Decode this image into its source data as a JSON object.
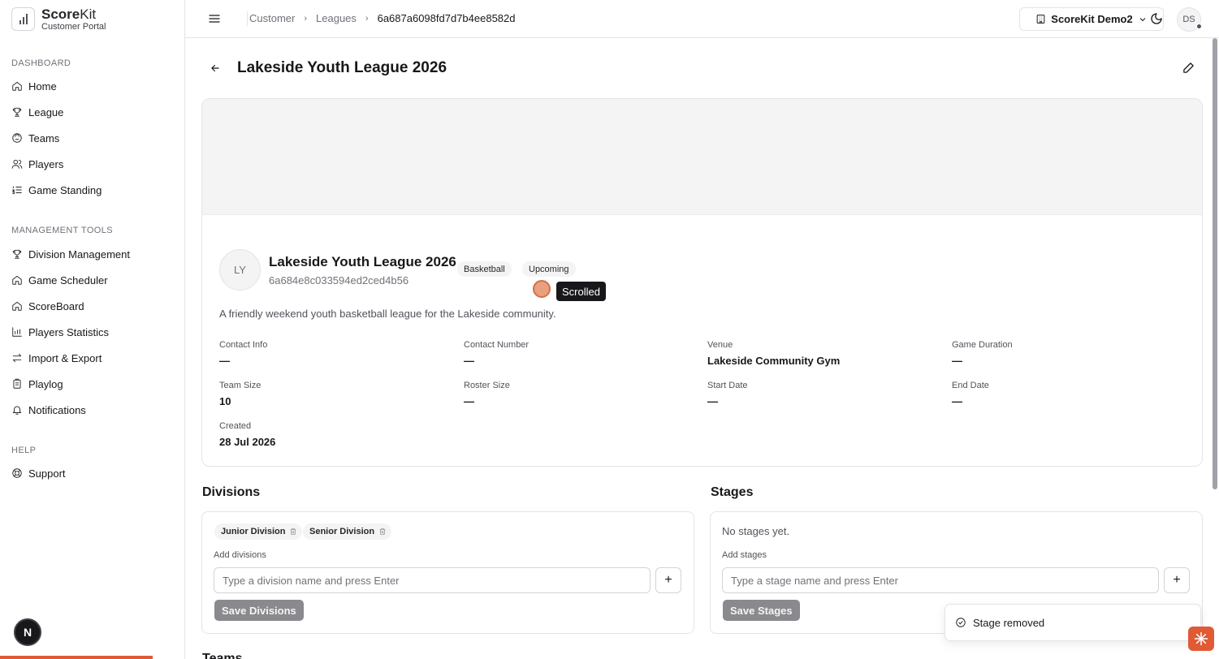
{
  "brand": {
    "name_bold": "Score",
    "name_regular": "Kit",
    "subtitle": "Customer Portal"
  },
  "sidebar": {
    "sections": [
      {
        "title": "DASHBOARD",
        "items": [
          "Home",
          "League",
          "Teams",
          "Players",
          "Game Standing"
        ]
      },
      {
        "title": "MANAGEMENT TOOLS",
        "items": [
          "Division Management",
          "Game Scheduler",
          "ScoreBoard",
          "Players Statistics",
          "Import & Export",
          "Playlog",
          "Notifications"
        ]
      },
      {
        "title": "HELP",
        "items": [
          "Support"
        ]
      }
    ],
    "bottom_badge": "N"
  },
  "topbar": {
    "breadcrumbs": [
      "Customer",
      "Leagues",
      "6a687a6098fd7d7b4ee8582d"
    ],
    "org": "ScoreKit Demo2",
    "user_initials": "DS"
  },
  "page": {
    "title": "Lakeside Youth League 2026"
  },
  "league": {
    "initials": "LY",
    "name": "Lakeside Youth League 2026",
    "id": "6a684e8c033594ed2ced4b56",
    "sport": "Basketball",
    "status": "Upcoming",
    "description": "A friendly weekend youth basketball league for the Lakeside community.",
    "fields": [
      {
        "label": "Contact Info",
        "value": "—"
      },
      {
        "label": "Contact Number",
        "value": "—"
      },
      {
        "label": "Venue",
        "value": "Lakeside Community Gym"
      },
      {
        "label": "Game Duration",
        "value": "—"
      },
      {
        "label": "Team Size",
        "value": "10"
      },
      {
        "label": "Roster Size",
        "value": "—"
      },
      {
        "label": "Start Date",
        "value": "—"
      },
      {
        "label": "End Date",
        "value": "—"
      },
      {
        "label": "Created",
        "value": "28 Jul 2026"
      }
    ]
  },
  "tooltip": "Scrolled",
  "divisions": {
    "title": "Divisions",
    "chips": [
      "Junior Division",
      "Senior Division"
    ],
    "add_label": "Add divisions",
    "placeholder": "Type a division name and press Enter",
    "save_label": "Save Divisions"
  },
  "stages": {
    "title": "Stages",
    "empty": "No stages yet.",
    "add_label": "Add stages",
    "placeholder": "Type a stage name and press Enter",
    "save_label": "Save Stages"
  },
  "next_section": "Teams",
  "toast": {
    "message": "Stage removed"
  },
  "colors": {
    "accent": "#e05a36",
    "muted_button": "#8a8a8e"
  }
}
